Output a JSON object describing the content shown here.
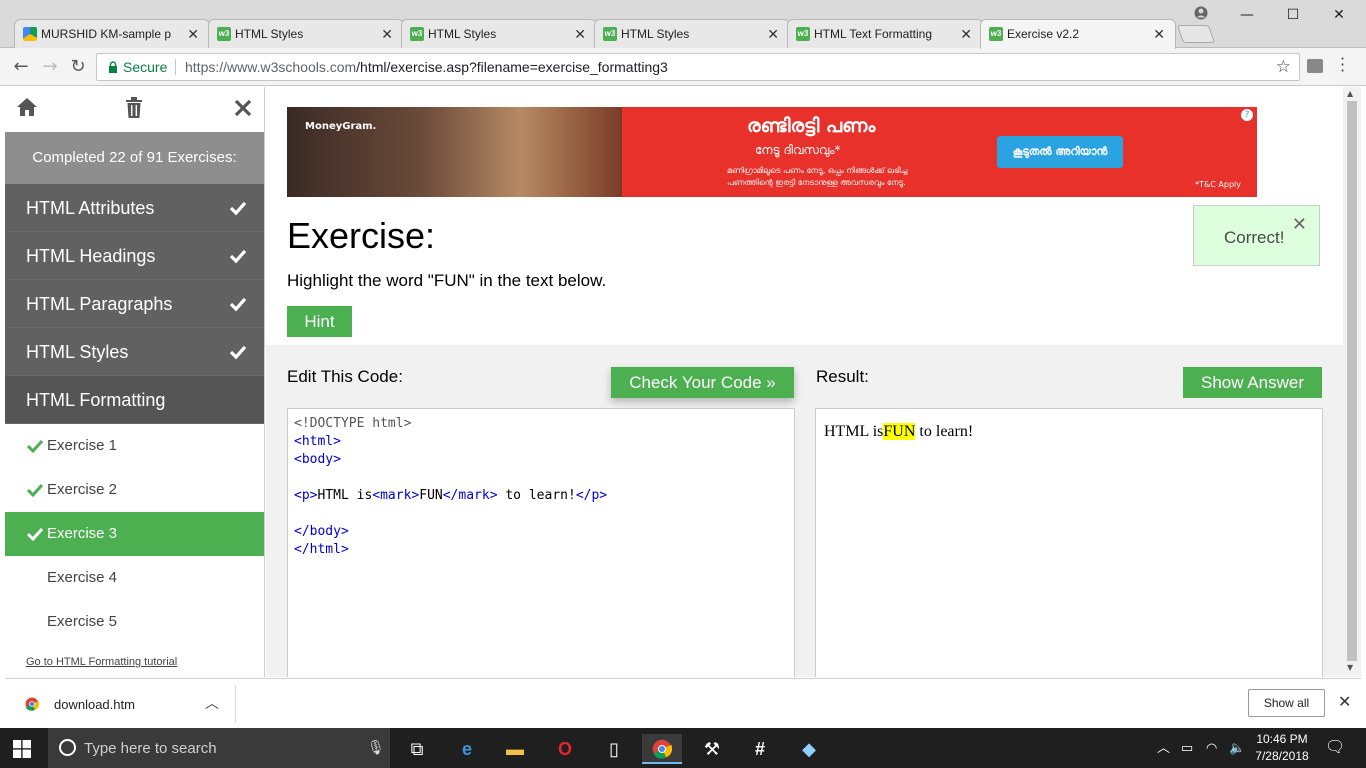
{
  "browser": {
    "tabs": [
      {
        "title": "MURSHID KM-sample pr",
        "favicon": "google-drive-icon"
      },
      {
        "title": "HTML Styles",
        "favicon": "w3schools-icon"
      },
      {
        "title": "HTML Styles",
        "favicon": "w3schools-icon"
      },
      {
        "title": "HTML Styles",
        "favicon": "w3schools-icon"
      },
      {
        "title": "HTML Text Formatting",
        "favicon": "w3schools-icon"
      },
      {
        "title": "Exercise v2.2",
        "favicon": "w3schools-icon"
      }
    ],
    "secure_label": "Secure",
    "url_domain": "https://www.w3schools.com",
    "url_path": "/html/exercise.asp?filename=exercise_formatting3"
  },
  "sidebar": {
    "progress": "Completed 22 of 91 Exercises:",
    "sections": [
      {
        "label": "HTML Attributes",
        "done": true
      },
      {
        "label": "HTML Headings",
        "done": true
      },
      {
        "label": "HTML Paragraphs",
        "done": true
      },
      {
        "label": "HTML Styles",
        "done": true
      },
      {
        "label": "HTML Formatting",
        "done": false
      }
    ],
    "exercises": [
      {
        "label": "Exercise 1",
        "done": true
      },
      {
        "label": "Exercise 2",
        "done": true
      },
      {
        "label": "Exercise 3",
        "done": true
      },
      {
        "label": "Exercise 4",
        "done": false
      },
      {
        "label": "Exercise 5",
        "done": false
      }
    ],
    "tutorial_link": "Go to HTML Formatting tutorial"
  },
  "ad": {
    "brand": "MoneyGram.",
    "title": "രണ്ടിരട്ടി പണം",
    "subtitle": "നേടൂ ദിവസവും*",
    "small_text": "മണിഗ്രാമിലൂടെ പണം നേടൂ, ഒപ്പം നിങ്ങൾക്ക് ലഭിച്ച പണത്തിന്റെ ഇരട്ടി നേടാനുള്ള അവസരവും നേടൂ.",
    "button": "കൂടുതൽ അറിയാൻ",
    "tc": "*T&C Apply"
  },
  "exercise": {
    "heading": "Exercise:",
    "instruction": "Highlight the word \"FUN\" in the text below.",
    "hint": "Hint",
    "correct": "Correct!",
    "edit_label": "Edit This Code:",
    "check_button": "Check Your Code »",
    "result_label": "Result:",
    "answer_button": "Show Answer",
    "code": {
      "l1": "<!DOCTYPE html>",
      "l2": "<html>",
      "l3": "<body>",
      "l4a": "<p>",
      "l4b": "HTML is",
      "l4c": "<mark>",
      "l4d": "FUN",
      "l4e": "</mark>",
      "l4f": " to learn!",
      "l4g": "</p>",
      "l5": "</body>",
      "l6": "</html>"
    },
    "result": {
      "before": "HTML is",
      "marked": "FUN",
      "after": " to learn!"
    }
  },
  "downloads": {
    "file": "download.htm",
    "show_all": "Show all"
  },
  "taskbar": {
    "search_placeholder": "Type here to search",
    "time": "10:46 PM",
    "date": "7/28/2018"
  },
  "colors": {
    "accent": "#4CAF50",
    "sidebar_dark": "#616161",
    "progress_bar": "#8e8e8e",
    "highlight": "#ffff00"
  }
}
